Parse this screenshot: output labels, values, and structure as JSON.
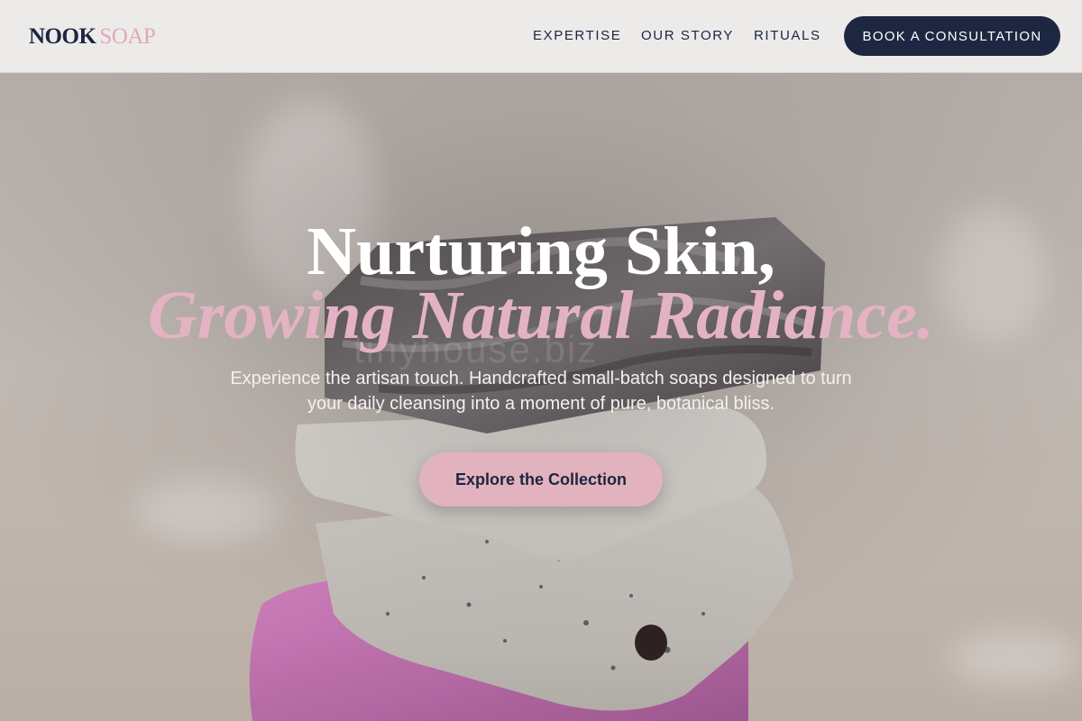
{
  "brand": {
    "name_part_1": "NOOK",
    "name_part_2": "SOAP",
    "primary_color": "#1c2540",
    "accent_color": "#e2b2bf"
  },
  "nav": {
    "links": [
      {
        "label": "EXPERTISE"
      },
      {
        "label": "OUR STORY"
      },
      {
        "label": "RITUALS"
      }
    ],
    "cta_label": "BOOK A CONSULTATION"
  },
  "hero": {
    "headline_line_1": "Nurturing Skin,",
    "headline_line_2": "Growing Natural Radiance.",
    "subtext": "Experience the artisan touch. Handcrafted small-batch soaps designed to turn your daily cleansing into a moment of pure, botanical bliss.",
    "button_label": "Explore the Collection",
    "watermark": "tinyhouse.biz",
    "image_subject": "stacked-handmade-soap-bars"
  }
}
